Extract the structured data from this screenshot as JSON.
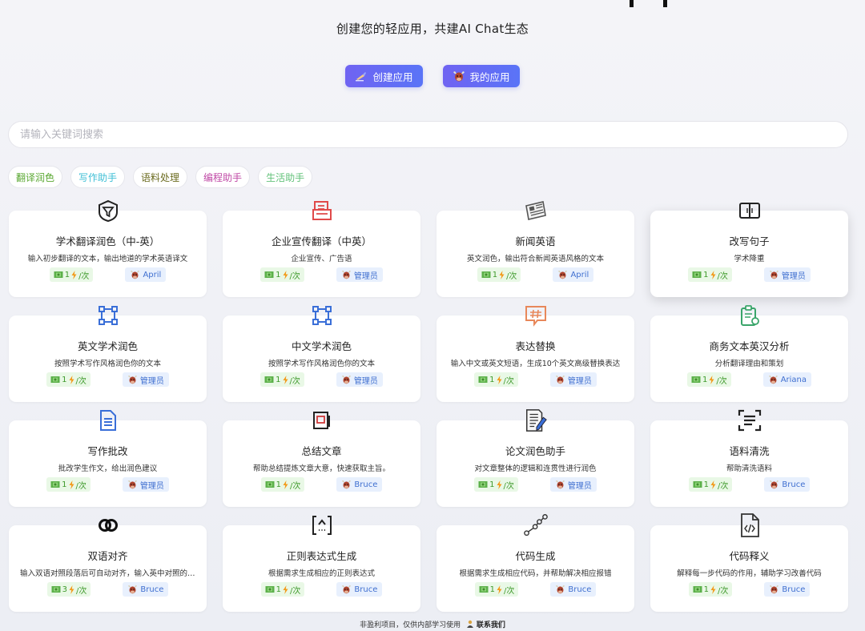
{
  "header": {
    "subtitle": "创建您的轻应用，共建AI Chat生态",
    "create_button": "创建应用",
    "my_apps_button": "我的应用"
  },
  "search": {
    "placeholder": "请输入关键词搜索",
    "value": ""
  },
  "tags": [
    {
      "label": "翻译润色",
      "color": "#5aa832"
    },
    {
      "label": "写作助手",
      "color": "#3fbfd6"
    },
    {
      "label": "语料处理",
      "color": "#6b6b1f"
    },
    {
      "label": "编程助手",
      "color": "#c04aa6"
    },
    {
      "label": "生活助手",
      "color": "#63c27a"
    }
  ],
  "cards": [
    {
      "title": "学术翻译润色（中-英）",
      "desc": "输入初步翻译的文本，输出地道的学术英语译文",
      "cost": "1",
      "unit": "/次",
      "author": "April",
      "icon": "shield-funnel-icon",
      "icon_color": "#222222"
    },
    {
      "title": "企业宣传翻译（中英）",
      "desc": "企业宣传、广告语",
      "cost": "1",
      "unit": "/次",
      "author": "管理员",
      "icon": "document-stack-icon",
      "icon_color": "#e04a4a"
    },
    {
      "title": "新闻英语",
      "desc": "英文润色，输出符合新闻英语风格的文本",
      "cost": "1",
      "unit": "/次",
      "author": "April",
      "icon": "newspaper-icon",
      "icon_color": "#555555"
    },
    {
      "title": "改写句子",
      "desc": "学术降重",
      "cost": "1",
      "unit": "/次",
      "author": "管理员",
      "icon": "book-icon",
      "icon_color": "#222222"
    },
    {
      "title": "英文学术润色",
      "desc": "按照学术写作风格润色你的文本",
      "cost": "1",
      "unit": "/次",
      "author": "管理员",
      "icon": "nodes-icon",
      "icon_color": "#3a6fd8"
    },
    {
      "title": "中文学术润色",
      "desc": "按照学术写作风格润色你的文本",
      "cost": "1",
      "unit": "/次",
      "author": "管理员",
      "icon": "nodes-icon",
      "icon_color": "#3a6fd8"
    },
    {
      "title": "表达替换",
      "desc": "输入中文或英文短语，生成10个英文高级替换表达",
      "cost": "1",
      "unit": "/次",
      "author": "管理员",
      "icon": "hashtag-chat-icon",
      "icon_color": "#e8885a"
    },
    {
      "title": "商务文本英汉分析",
      "desc": "分析翻译理由和策划",
      "cost": "1",
      "unit": "/次",
      "author": "Ariana",
      "icon": "clipboard-icon",
      "icon_color": "#3aa56a"
    },
    {
      "title": "写作批改",
      "desc": "批改学生作文，给出润色建议",
      "cost": "1",
      "unit": "/次",
      "author": "管理员",
      "icon": "document-icon",
      "icon_color": "#3a6fd8"
    },
    {
      "title": "总结文章",
      "desc": "帮助总结提炼文章大意，快速获取主旨。",
      "cost": "1",
      "unit": "/次",
      "author": "Bruce",
      "icon": "slides-icon",
      "icon_color": "#222222"
    },
    {
      "title": "论文润色助手",
      "desc": "对文章整体的逻辑和连贯性进行润色",
      "cost": "1",
      "unit": "/次",
      "author": "管理员",
      "icon": "paper-pen-icon",
      "icon_color": "#333333"
    },
    {
      "title": "语料清洗",
      "desc": "帮助清洗语料",
      "cost": "1",
      "unit": "/次",
      "author": "Bruce",
      "icon": "scan-text-icon",
      "icon_color": "#222222"
    },
    {
      "title": "双语对齐",
      "desc": "输入双语对照段落后可自动对齐，输入英中对照的文本",
      "cost": "3",
      "unit": "/次",
      "author": "Bruce",
      "icon": "rings-icon",
      "icon_color": "#111111"
    },
    {
      "title": "正则表达式生成",
      "desc": "根据需求生成相应的正则表达式",
      "cost": "1",
      "unit": "/次",
      "author": "Bruce",
      "icon": "regex-bracket-icon",
      "icon_color": "#222222"
    },
    {
      "title": "代码生成",
      "desc": "根据需求生成相应代码，并帮助解决相应报错",
      "cost": "1",
      "unit": "/次",
      "author": "Bruce",
      "icon": "graph-path-icon",
      "icon_color": "#333333"
    },
    {
      "title": "代码释义",
      "desc": "解释每一步代码的作用，辅助学习改善代码",
      "cost": "1",
      "unit": "/次",
      "author": "Bruce",
      "icon": "code-file-icon",
      "icon_color": "#333333"
    }
  ],
  "footer": {
    "text": "非盈利项目，仅供内部学习使用",
    "link": "联系我们"
  }
}
